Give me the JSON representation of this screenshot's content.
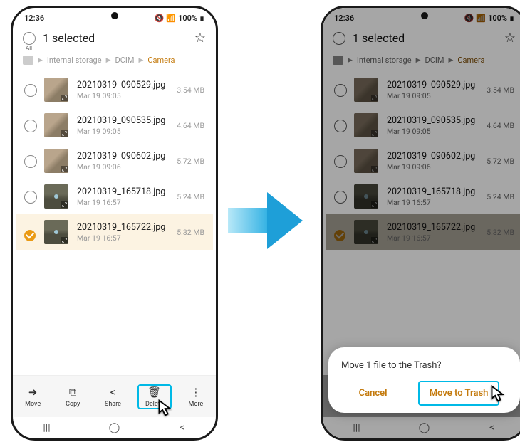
{
  "status": {
    "time": "12:36",
    "battery": "100%"
  },
  "header": {
    "title": "1 selected",
    "all_label": "All"
  },
  "breadcrumbs": {
    "b1": "Internal storage",
    "b2": "DCIM",
    "b3": "Camera"
  },
  "files": [
    {
      "name": "20210319_090529.jpg",
      "date": "Mar 19 09:05",
      "size": "3.54 MB",
      "selected": false,
      "thumb": "light"
    },
    {
      "name": "20210319_090535.jpg",
      "date": "Mar 19 09:05",
      "size": "4.64 MB",
      "selected": false,
      "thumb": "light"
    },
    {
      "name": "20210319_090602.jpg",
      "date": "Mar 19 09:06",
      "size": "5.72 MB",
      "selected": false,
      "thumb": "light"
    },
    {
      "name": "20210319_165718.jpg",
      "date": "Mar 19 16:57",
      "size": "5.24 MB",
      "selected": false,
      "thumb": "dark"
    },
    {
      "name": "20210319_165722.jpg",
      "date": "Mar 19 16:57",
      "size": "5.32 MB",
      "selected": true,
      "thumb": "dark"
    }
  ],
  "toolbar": {
    "move": "Move",
    "copy": "Copy",
    "share": "Share",
    "delete": "Delete",
    "more": "More"
  },
  "dialog": {
    "message": "Move 1 file to the Trash?",
    "cancel": "Cancel",
    "confirm": "Move to Trash"
  }
}
